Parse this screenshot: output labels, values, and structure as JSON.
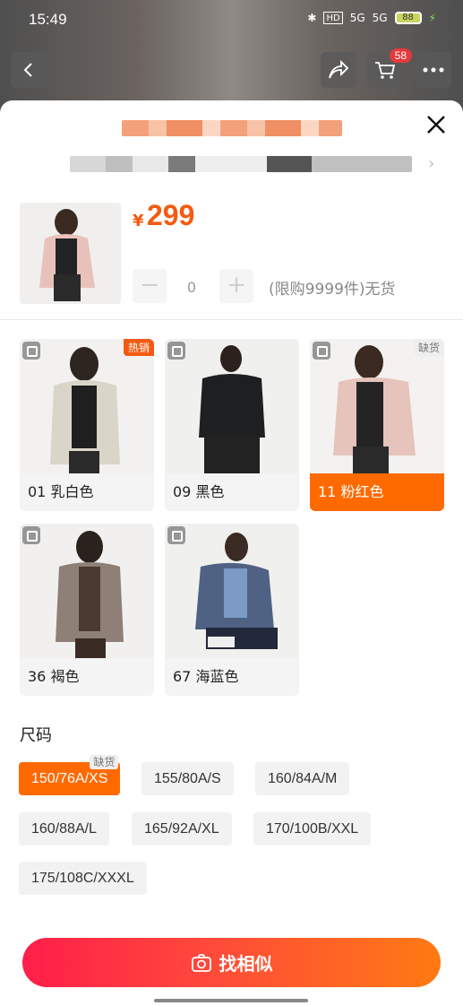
{
  "status_bar": {
    "time": "15:49",
    "hd_label": "HD",
    "signal1_label": "5G",
    "signal2_label": "5G",
    "battery_label": "88"
  },
  "header": {
    "cart_count": "58"
  },
  "product": {
    "price_symbol": "¥",
    "price": "299",
    "quantity": "0",
    "limit_text": "(限购9999件)无货"
  },
  "colors": [
    {
      "label": "01 乳白色",
      "badge": "热销"
    },
    {
      "label": "09 黑色",
      "badge": ""
    },
    {
      "label": "11 粉红色",
      "badge": "缺货"
    },
    {
      "label": "36 褐色",
      "badge": ""
    },
    {
      "label": "67 海蓝色",
      "badge": ""
    }
  ],
  "sizes": {
    "title": "尺码",
    "items": [
      {
        "label": "150/76A/XS",
        "badge": "缺货"
      },
      {
        "label": "155/80A/S"
      },
      {
        "label": "160/84A/M"
      },
      {
        "label": "160/88A/L"
      },
      {
        "label": "165/92A/XL"
      },
      {
        "label": "170/100B/XXL"
      },
      {
        "label": "175/108C/XXXL"
      }
    ]
  },
  "action": {
    "find_similar_label": "找相似"
  },
  "theme": {
    "accent": "#ff6a00",
    "price_color": "#f45a12",
    "button_gradient_start": "#ff1e4a",
    "button_gradient_end": "#ff7a12"
  },
  "icons": [
    "back-icon",
    "share-icon",
    "cart-icon",
    "more-icon",
    "close-icon",
    "chevron-right-icon",
    "zoom-icon",
    "minus-icon",
    "plus-icon",
    "camera-icon"
  ]
}
